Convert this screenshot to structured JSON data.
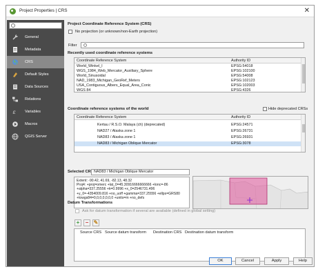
{
  "window": {
    "title": "Project Properties | CRS"
  },
  "sidebar": {
    "search_placeholder": "",
    "items": [
      {
        "label": "General",
        "icon": "wrench-icon"
      },
      {
        "label": "Metadata",
        "icon": "metadata-icon"
      },
      {
        "label": "CRS",
        "icon": "globe-icon"
      },
      {
        "label": "Default Styles",
        "icon": "styles-icon"
      },
      {
        "label": "Data Sources",
        "icon": "database-icon"
      },
      {
        "label": "Relations",
        "icon": "relations-icon"
      },
      {
        "label": "Variables",
        "icon": "variables-icon"
      },
      {
        "label": "Macros",
        "icon": "macros-icon"
      },
      {
        "label": "QGIS Server",
        "icon": "server-icon"
      }
    ],
    "active_index": 2
  },
  "crs_section": {
    "title": "Project Coordinate Reference System (CRS)",
    "no_projection_label": "No projection (or unknown/non-Earth projection)",
    "filter_label": "Filter"
  },
  "recent": {
    "title": "Recently used coordinate reference systems",
    "headers": [
      "Coordinate Reference System",
      "Authority ID"
    ],
    "rows": [
      [
        "World_Winkel_I",
        "EPSG:54018"
      ],
      [
        "WGS_1984_Web_Mercator_Auxiliary_Sphere",
        "EPSG:102100"
      ],
      [
        "World_Sinusoidal",
        "EPSG:54008"
      ],
      [
        "NAD_1983_Michigan_GeoRef_Meters",
        "EPSG:102123"
      ],
      [
        "USA_Contiguous_Albers_Equal_Area_Conic",
        "EPSG:102003"
      ],
      [
        "WGS 84",
        "EPSG:4326"
      ]
    ]
  },
  "world": {
    "title": "Coordinate reference systems of the world",
    "hide_deprecated_label": "Hide deprecated CRSs",
    "headers": [
      "Coordinate Reference System",
      "Authority ID"
    ],
    "rows": [
      [
        "Kertau / R.S.O. Malaya (ch) (deprecated)",
        "EPSG:24571"
      ],
      [
        "NAD27 / Alaska zone 1",
        "EPSG:26731"
      ],
      [
        "NAD83 / Alaska zone 1",
        "EPSG:26931"
      ],
      [
        "NAD83 / Michigan Oblique Mercator",
        "EPSG:3078"
      ]
    ],
    "selected_index": 3
  },
  "selected": {
    "label": "Selected CRS",
    "value": "NAD83 / Michigan Oblique Mercator",
    "wkt_lines": [
      "Extent: -90.42, 41.69, -82.13, 48.32",
      "Proj4: +proj=omerc +lat_0=45.30916666666666 +lonc=-86",
      "+alpha=337.25556 +k=0.9996 +x_0=2546731.496",
      "+y_0=-4354009.816 +no_uoff +gamma=337.25556 +ellps=GRS80",
      "+towgs84=0,0,0,0,0,0,0 +units=m +no_defs"
    ]
  },
  "datum": {
    "title": "Datum Transformations",
    "ask_label": "Ask for datum transformation if several are available (defined in global setting)",
    "headers": [
      "Source CRS",
      "Source datum transform",
      "Destination CRS",
      "Destination datum transform"
    ]
  },
  "footer": {
    "ok": "OK",
    "cancel": "Cancel",
    "apply": "Apply",
    "help": "Help"
  },
  "colors": {
    "sidebar_bg": "#4a4a4a",
    "selection": "#cfe2f6",
    "accent": "#589632",
    "map_highlight": "#e0559a"
  }
}
